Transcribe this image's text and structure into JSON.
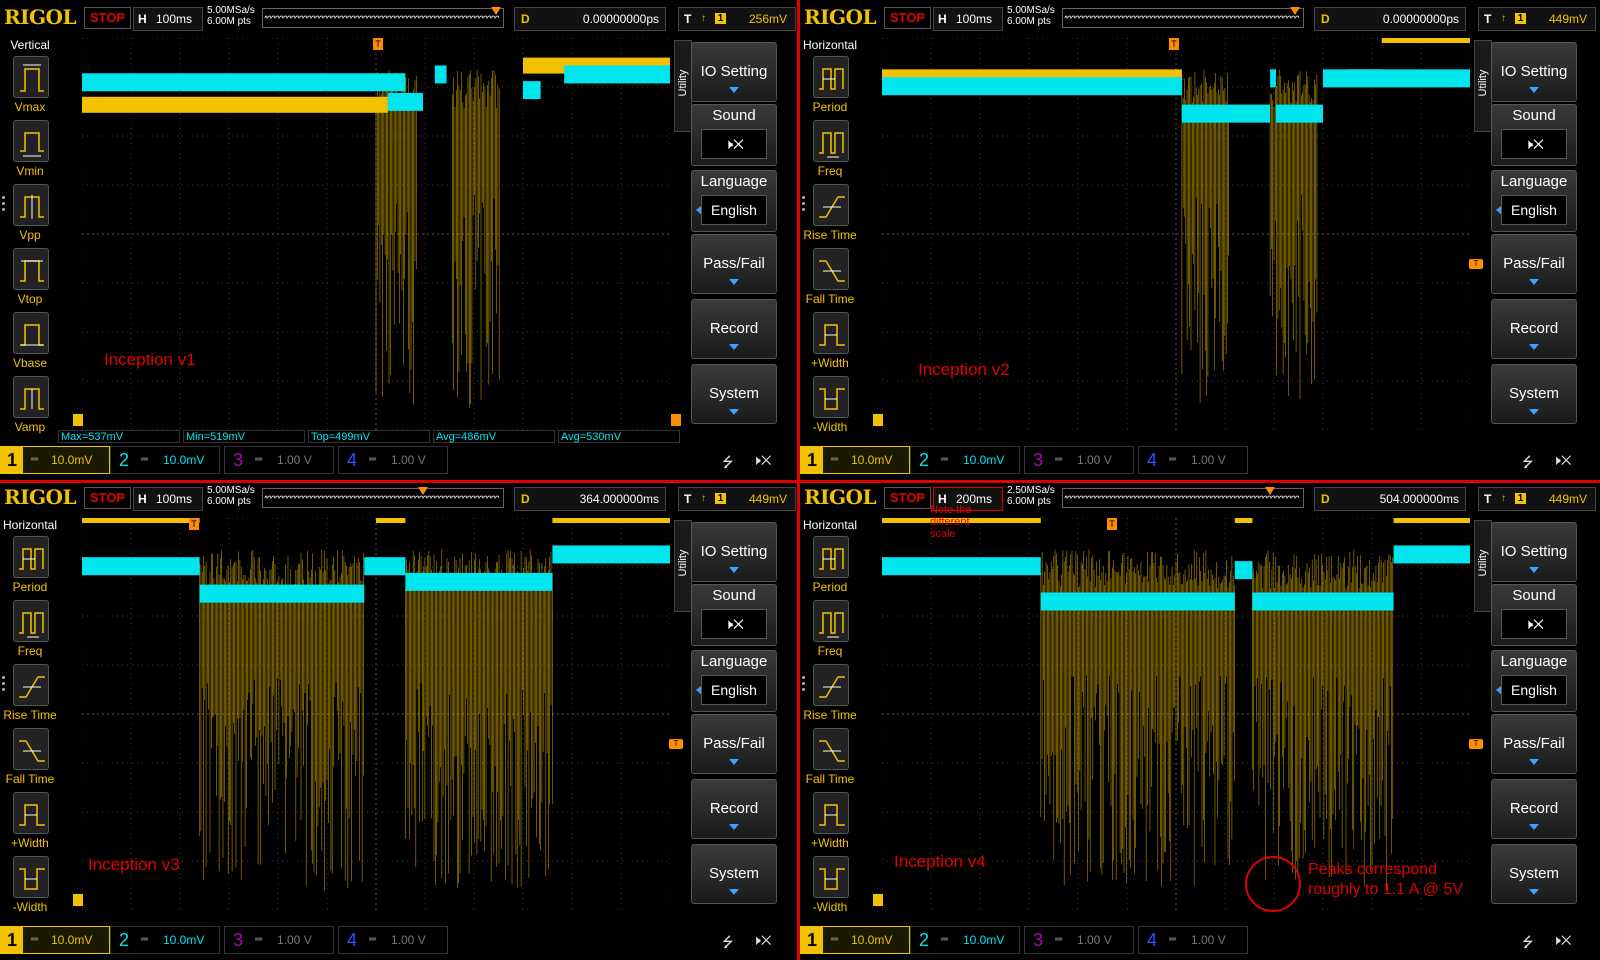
{
  "colors": {
    "ch1": "#f2c200",
    "ch2": "#00e5ee",
    "trigger": "#ff8c00",
    "annotation": "#e00000",
    "brand": "#f2c200"
  },
  "screens": [
    {
      "brand": "RIGOL",
      "status": "STOP",
      "timebase_key": "H",
      "timebase": "100ms",
      "sample_rate": "5.00MSa/s",
      "memory_depth": "6.00M pts",
      "delay_key": "D",
      "delay": "0.00000000ps",
      "trigger_key": "T",
      "trigger_channel": "1",
      "trigger_level": "256mV",
      "menu_title": "Vertical",
      "menu_items": [
        "Vmax",
        "Vmin",
        "Vpp",
        "Vtop",
        "Vbase",
        "Vamp"
      ],
      "plot_label": "Inception v1",
      "measurements": [
        "Max=537mV",
        "Min=519mV",
        "Top=499mV",
        "Avg=486mV",
        "Avg=530mV"
      ],
      "utility_tab": "Utility",
      "buttons": {
        "io": "IO Setting",
        "sound": "Sound",
        "language": "Language",
        "language_value": "English",
        "passfail": "Pass/Fail",
        "record": "Record",
        "system": "System"
      },
      "channels": [
        {
          "num": "1",
          "scale": "10.0mV"
        },
        {
          "num": "2",
          "scale": "10.0mV"
        },
        {
          "num": "3",
          "scale": "1.00 V"
        },
        {
          "num": "4",
          "scale": "1.00 V"
        }
      ]
    },
    {
      "brand": "RIGOL",
      "status": "STOP",
      "timebase_key": "H",
      "timebase": "100ms",
      "sample_rate": "5.00MSa/s",
      "memory_depth": "6.00M pts",
      "delay_key": "D",
      "delay": "0.00000000ps",
      "trigger_key": "T",
      "trigger_channel": "1",
      "trigger_level": "449mV",
      "menu_title": "Horizontal",
      "menu_items": [
        "Period",
        "Freq",
        "Rise Time",
        "Fall Time",
        "+Width",
        "-Width"
      ],
      "plot_label": "Inception v2",
      "utility_tab": "Utility",
      "buttons": {
        "io": "IO Setting",
        "sound": "Sound",
        "language": "Language",
        "language_value": "English",
        "passfail": "Pass/Fail",
        "record": "Record",
        "system": "System"
      },
      "channels": [
        {
          "num": "1",
          "scale": "10.0mV"
        },
        {
          "num": "2",
          "scale": "10.0mV"
        },
        {
          "num": "3",
          "scale": "1.00 V"
        },
        {
          "num": "4",
          "scale": "1.00 V"
        }
      ]
    },
    {
      "brand": "RIGOL",
      "status": "STOP",
      "timebase_key": "H",
      "timebase": "100ms",
      "sample_rate": "5.00MSa/s",
      "memory_depth": "6.00M pts",
      "delay_key": "D",
      "delay": "364.000000ms",
      "trigger_key": "T",
      "trigger_channel": "1",
      "trigger_level": "449mV",
      "menu_title": "Horizontal",
      "menu_items": [
        "Period",
        "Freq",
        "Rise Time",
        "Fall Time",
        "+Width",
        "-Width"
      ],
      "plot_label": "Inception v3",
      "utility_tab": "Utility",
      "buttons": {
        "io": "IO Setting",
        "sound": "Sound",
        "language": "Language",
        "language_value": "English",
        "passfail": "Pass/Fail",
        "record": "Record",
        "system": "System"
      },
      "channels": [
        {
          "num": "1",
          "scale": "10.0mV"
        },
        {
          "num": "2",
          "scale": "10.0mV"
        },
        {
          "num": "3",
          "scale": "1.00 V"
        },
        {
          "num": "4",
          "scale": "1.00 V"
        }
      ]
    },
    {
      "brand": "RIGOL",
      "status": "STOP",
      "timebase_key": "H",
      "timebase": "200ms",
      "sample_rate": "2.50MSa/s",
      "memory_depth": "6.00M pts",
      "delay_key": "D",
      "delay": "504.000000ms",
      "trigger_key": "T",
      "trigger_channel": "1",
      "trigger_level": "449mV",
      "menu_title": "Horizontal",
      "menu_items": [
        "Period",
        "Freq",
        "Rise Time",
        "Fall Time",
        "+Width",
        "-Width"
      ],
      "plot_label": "Inception v4",
      "scale_note": "Note the different scale",
      "peak_note": "Peaks correspond roughly to 1.1 A @ 5V",
      "utility_tab": "Utility",
      "buttons": {
        "io": "IO Setting",
        "sound": "Sound",
        "language": "Language",
        "language_value": "English",
        "passfail": "Pass/Fail",
        "record": "Record",
        "system": "System"
      },
      "channels": [
        {
          "num": "1",
          "scale": "10.0mV"
        },
        {
          "num": "2",
          "scale": "10.0mV"
        },
        {
          "num": "3",
          "scale": "1.00 V"
        },
        {
          "num": "4",
          "scale": "1.00 V"
        }
      ]
    }
  ]
}
